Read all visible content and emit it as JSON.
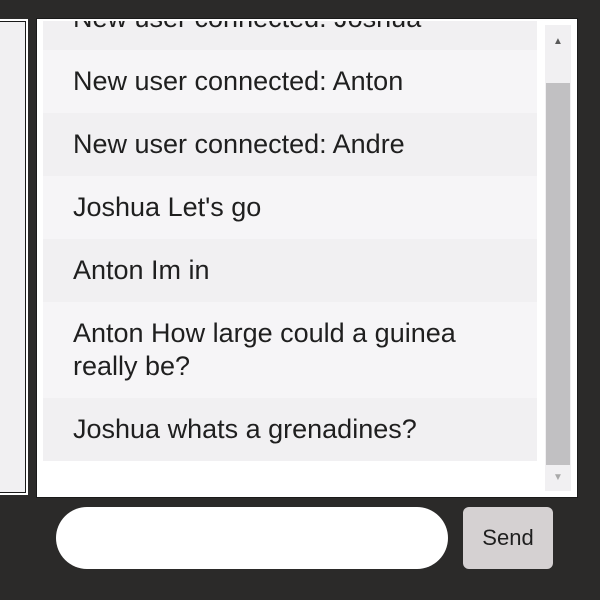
{
  "chat": {
    "messages": [
      "New user connected: Joshua",
      "New user connected: Anton",
      "New user connected: Andre",
      "Joshua Let's go",
      "Anton Im in",
      "Anton How large could a guinea really be?",
      "Joshua whats a grenadines?"
    ]
  },
  "scrollbar": {
    "up_icon": "▲",
    "down_icon": "▼"
  },
  "composer": {
    "input_value": "",
    "send_label": "Send"
  }
}
